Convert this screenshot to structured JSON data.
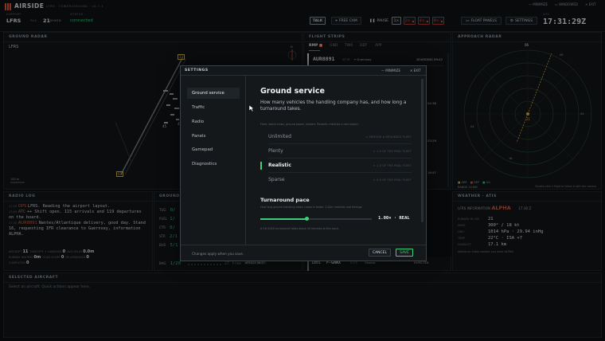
{
  "app": {
    "name": "AIRSIDE",
    "subtitle": "LFRS · TOWER/GROUND · v0.7.3"
  },
  "header": {
    "airport_label": "AIRPORT",
    "airport": "LFRS",
    "pax_label": "PAX",
    "pax_count": "21",
    "pax_suffix": "MIXED",
    "status_label": "STATUS",
    "status": "connected",
    "talk": "TALK",
    "free_cam": "FREE CAM",
    "pause": "PAUSE",
    "speeds": [
      "1×",
      "2×",
      "4×",
      "8×"
    ],
    "float_panels": "FLOAT PANELS",
    "settings": "SETTINGS",
    "utc_label": "UTC",
    "utc": "17:31:29Z",
    "minimize": "MINIMIZE",
    "windowed": "WINDOWED",
    "exit": "EXIT"
  },
  "ground_radar": {
    "title": "GROUND RADAR",
    "airport": "LFRS",
    "scale": "100 m",
    "labels": [
      "23",
      "03",
      "45",
      "42",
      "N"
    ]
  },
  "flight_strips": {
    "title": "FLIGHT STRIPS",
    "tabs": [
      "RMP",
      "GND",
      "TWR",
      "DEP",
      "APP"
    ],
    "rmp_badge": "3",
    "first": {
      "callsign": "AUR8891",
      "type": "AT76",
      "dest": "→ Guernsey",
      "status": "BOARDING 09:42"
    },
    "times": [
      "04:38",
      "03:29",
      "16:57"
    ],
    "bottom": {
      "num": "1801",
      "callsign": "F-GNWX",
      "type": "E175",
      "dest": "Geneva",
      "status": "EXPECTED"
    }
  },
  "approach_radar": {
    "title": "APPROACH RADAR",
    "scale": "RANGE 10 NM",
    "legend": [
      "ARR",
      "DEP",
      "GA"
    ],
    "hint": "Double-click a flight to follow it with the camera",
    "rings": [
      "06",
      "08",
      "04",
      "04",
      "21",
      "16"
    ]
  },
  "radio_log": {
    "title": "RADIO LOG",
    "entries": [
      {
        "time": "17:29",
        "who": "OPS",
        "text": "LFRS. Reading the airport layout."
      },
      {
        "time": "17:29",
        "who": "ATC",
        "text": "++ Shift open. 115 arrivals and 119 departures on the board."
      },
      {
        "time": "17:30",
        "who": "AUR8891",
        "text": "Nantes/Atlantique delivery, good day. Stand 16, requesting IFR clearance to Guernsey, information ALPHA."
      }
    ],
    "stats": [
      {
        "label": "AIRCRAFT",
        "value": "11"
      },
      {
        "label": "TAKEOFFS + LANDINGS",
        "value": "0"
      },
      {
        "label": "AVG DELAY",
        "value": "0.0m"
      },
      {
        "label": "RUNWAY WAITING",
        "value": "0m"
      },
      {
        "label": "HOLD SHORT",
        "value": "0"
      },
      {
        "label": "RE-ARRANGED",
        "value": "0"
      },
      {
        "label": "COMPLETED",
        "value": "0"
      }
    ]
  },
  "ground_services": {
    "title": "GROUND SERVICES",
    "rows": [
      {
        "code": "TUG",
        "val": "0/"
      },
      {
        "code": "FUEL",
        "val": "1/"
      },
      {
        "code": "CTR",
        "val": "0/"
      },
      {
        "code": "STR",
        "val": "2/1"
      },
      {
        "code": "BUS",
        "val": "5/1"
      },
      {
        "code": "BAG",
        "val": "1/20"
      }
    ],
    "bag_eta": "27 free",
    "bag_tag": "AFR023 06:57"
  },
  "weather": {
    "title": "WEATHER · ATIS",
    "info_label": "LFRS INFORMATION",
    "info": "ALPHA",
    "info_time": "17:30 Z",
    "rows": [
      {
        "k": "RUNWAY IN USE",
        "v": "21"
      },
      {
        "k": "WIND",
        "v": "300° / 18 kt"
      },
      {
        "k": "QNH",
        "v": "1014 hPa · 29.94 inHg"
      },
      {
        "k": "TEMP",
        "v": "22°C  ·  ISA +7"
      },
      {
        "k": "VISIBILITY",
        "v": "17.1 km"
      }
    ],
    "note": "Advise on initial contact you have ALPHA."
  },
  "selected_aircraft": {
    "title": "SELECTED AIRCRAFT",
    "hint": "Select an aircraft. Quick actions appear here."
  },
  "settings_modal": {
    "title": "SETTINGS",
    "minimize": "MINIMIZE",
    "exit": "EXIT",
    "nav": [
      "Ground service",
      "Traffic",
      "Radio",
      "Panels",
      "Gamepad",
      "Diagnostics"
    ],
    "heading": "Ground service",
    "description": "How many vehicles the handling company has, and how long a turnaround takes.",
    "fleet_hint": "Fleet, stand crews, ground power, loaders. Realistic matches a real airport.",
    "options": [
      {
        "name": "Unlimited",
        "desc": "× ENOUGH A SEQUENCE FLEET"
      },
      {
        "name": "Plenty",
        "desc": "× 1.5 OF THE REAL FLEET"
      },
      {
        "name": "Realistic",
        "desc": "× 1.0 OF THE REAL FLEET"
      },
      {
        "name": "Sparse",
        "desc": "× 0.6 OF THE REAL FLEET"
      }
    ],
    "selected_option": "Realistic",
    "pace_title": "Turnaround pace",
    "pace_hint": "How long ground handling takes. Lower is faster. 1.00× matches real timings.",
    "pace_value": "1.00× · REAL",
    "pace_fraction": 0.42,
    "pace_footnote": "A full A320 turnaround takes about 45 minutes at this pace.",
    "footer": "Changes apply when you save.",
    "cancel": "CANCEL",
    "save": "SAVE"
  }
}
